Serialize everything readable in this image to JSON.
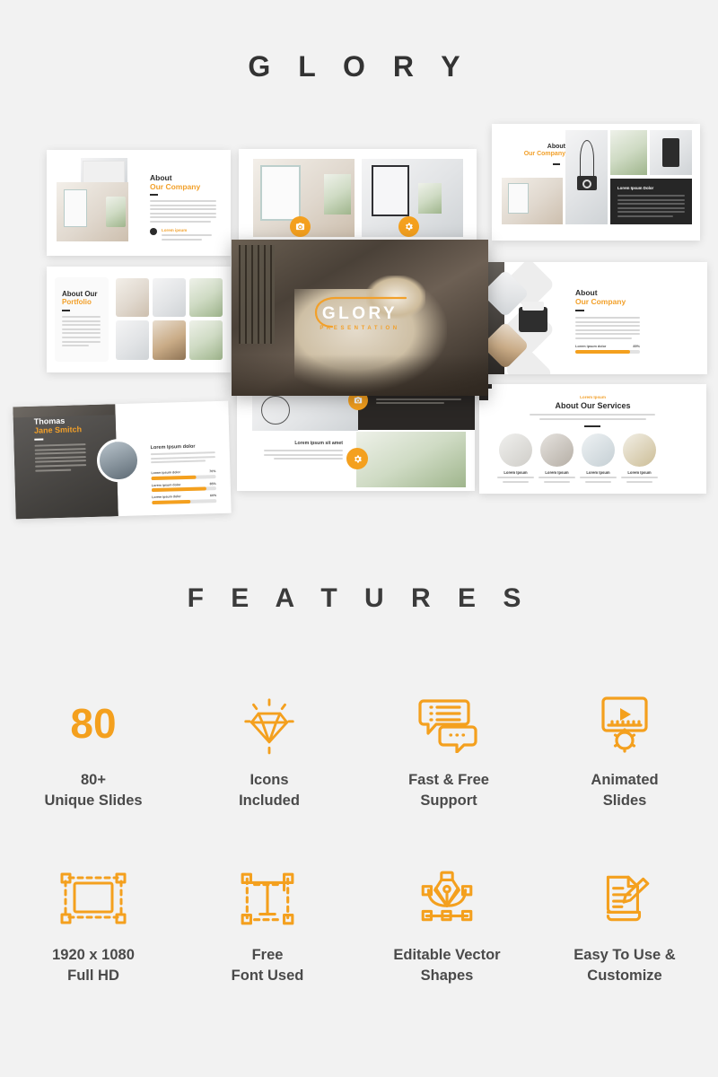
{
  "header": {
    "brand_title": "G L O R Y"
  },
  "features_section": {
    "title": "F E A T U R E S"
  },
  "colors": {
    "accent": "#F4A01E",
    "text_dark": "#333333",
    "background": "#F2F2F2",
    "panel_dark": "#2B2B2B"
  },
  "hero_slide": {
    "logo_text": "GLORY",
    "subtitle": "PRESENTATION"
  },
  "slides": [
    {
      "id": "about-our-company-1",
      "title_line1": "About",
      "title_line2": "Our Company",
      "body_note": "Lorem ipsum",
      "bullet_label": "Lorem ipsum"
    },
    {
      "id": "portfolio",
      "title_line1": "About Our",
      "title_line2": "Portfolio"
    },
    {
      "id": "team-profile",
      "title_line1": "Thomas",
      "title_line2": "Jane Smitch",
      "detail_title": "Lorem Ipsum dolor",
      "bars": [
        {
          "label": "Lorem ipsum dolor",
          "value": "70%",
          "pct": 70
        },
        {
          "label": "Lorem ipsum dolor",
          "value": "85%",
          "pct": 85
        },
        {
          "label": "Lorem ipsum dolor",
          "value": "60%",
          "pct": 60
        }
      ]
    },
    {
      "id": "gallery-two-up"
    },
    {
      "id": "about-our-company-2",
      "title_line1": "About",
      "title_line2": "Our Company",
      "dark_card_title": "Lorem Ipsum Dolor"
    },
    {
      "id": "about-our-company-3",
      "title_line1": "About",
      "title_line2": "Our Company",
      "bar": {
        "label": "Lorem ipsum dolor",
        "value": "85%",
        "pct": 85
      }
    },
    {
      "id": "lorem-ipsum-sit-amet",
      "heading": "Lorem ipsum sit amet"
    },
    {
      "id": "about-our-services",
      "eyebrow": "Lorem Ipsum",
      "title": "About Our Services",
      "cards": [
        {
          "label": "Lorem Ipsum"
        },
        {
          "label": "Lorem Ipsum"
        },
        {
          "label": "Lorem Ipsum"
        },
        {
          "label": "Lorem Ipsum"
        }
      ]
    }
  ],
  "features": [
    {
      "icon": "number-80-icon",
      "big_number": "80",
      "label_line1": "80+",
      "label_line2": "Unique Slides"
    },
    {
      "icon": "diamond-icon",
      "label_line1": "Icons",
      "label_line2": "Included"
    },
    {
      "icon": "chat-bubbles-icon",
      "label_line1": "Fast & Free",
      "label_line2": "Support"
    },
    {
      "icon": "animated-screen-gear-icon",
      "label_line1": "Animated",
      "label_line2": "Slides"
    },
    {
      "icon": "bounding-box-icon",
      "label_line1": "1920 x 1080",
      "label_line2": "Full HD"
    },
    {
      "icon": "text-type-icon",
      "label_line1": "Free",
      "label_line2": "Font Used"
    },
    {
      "icon": "pen-vector-icon",
      "label_line1": "Editable Vector",
      "label_line2": "Shapes"
    },
    {
      "icon": "document-pencil-icon",
      "label_line1": "Easy To Use &",
      "label_line2": "Customize"
    }
  ]
}
